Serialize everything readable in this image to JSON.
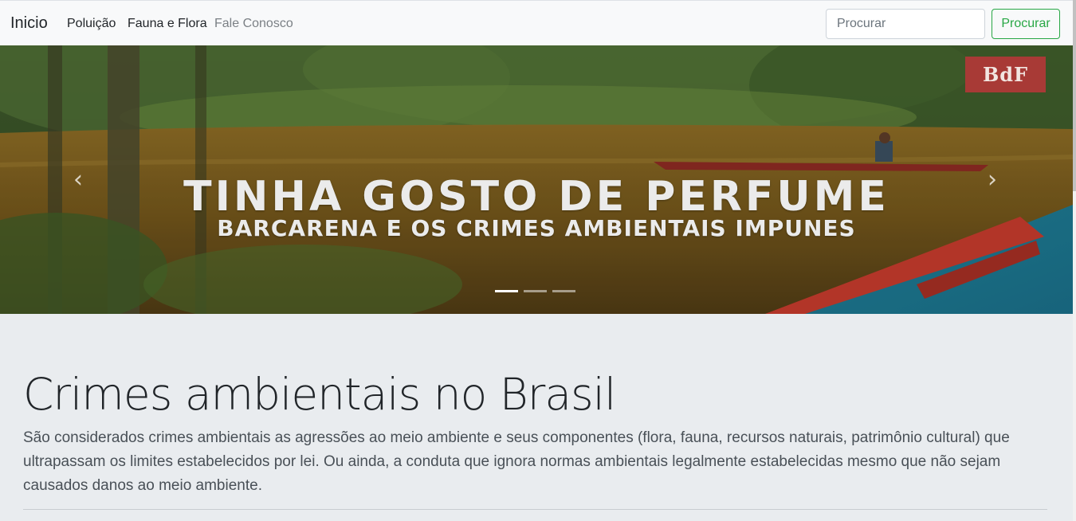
{
  "navbar": {
    "brand": "Inicio",
    "links": [
      {
        "label": "Poluição"
      },
      {
        "label": "Fauna e Flora"
      },
      {
        "label": "Fale Conosco"
      }
    ],
    "search": {
      "placeholder": "Procurar",
      "button_label": "Procurar"
    }
  },
  "carousel": {
    "slide_title": "TINHA GOSTO DE PERFUME",
    "slide_subtitle": "BARCARENA E OS CRIMES AMBIENTAIS IMPUNES",
    "logo_text": "BdF",
    "prev_icon": "chevron-left-icon",
    "next_icon": "chevron-right-icon",
    "indicator_count": 3,
    "active_indicator": 0
  },
  "jumbotron": {
    "title": "Crimes ambientais no Brasil",
    "lead": "São considerados crimes ambientais as agressões ao meio ambiente e seus componentes (flora, fauna, recursos naturais, patrimônio cultural) que ultrapassam os limites estabelecidos por lei. Ou ainda, a conduta que ignora normas ambientais legalmente estabelecidas mesmo que não sejam causados danos ao meio ambiente."
  },
  "colors": {
    "success": "#28a745",
    "navbar_bg": "#f8f9fa",
    "page_bg": "#e9ecef",
    "logo_bg": "#a83a36"
  }
}
